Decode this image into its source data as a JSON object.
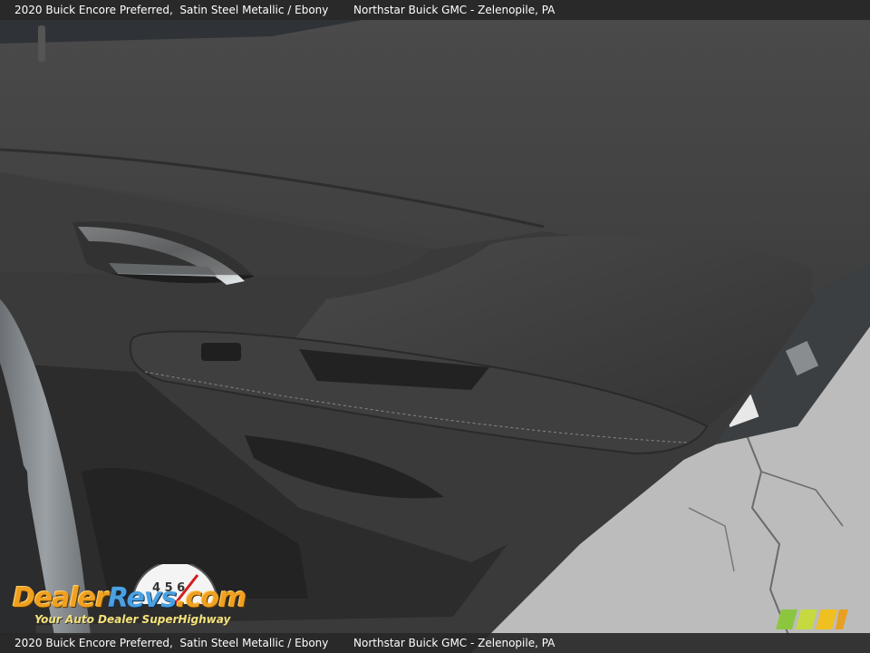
{
  "caption": {
    "vehicle": "2020 Buick Encore Preferred,  Satin Steel Metallic / Ebony",
    "dealer": "Northstar Buick GMC - Zelenopile, PA"
  },
  "watermark": {
    "brand_part1": "Dealer",
    "brand_part2": "Revs",
    "brand_part3": ".com",
    "tagline": "Your Auto Dealer SuperHighway",
    "gauge_digits": "4 5 6"
  },
  "colors": {
    "caption_bg": "#282828",
    "panel": "#3a3a3a",
    "panel_dark": "#262626",
    "pavement": "#bdbdbd",
    "accent_orange": "#f0a020",
    "accent_blue": "#4aa0e0"
  }
}
